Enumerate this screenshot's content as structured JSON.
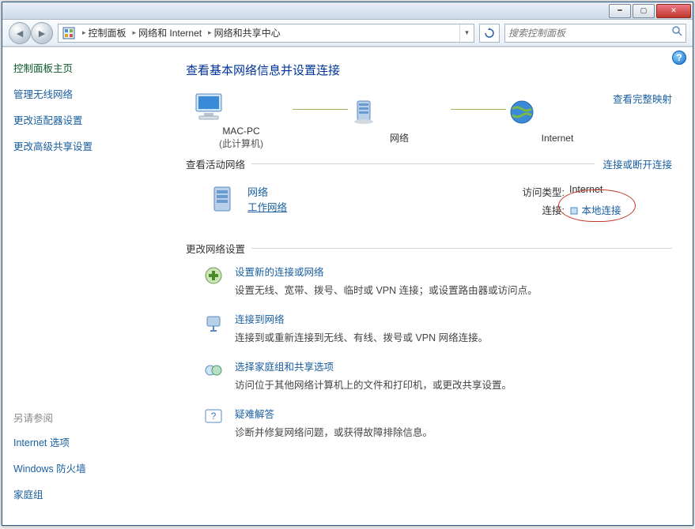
{
  "breadcrumb": {
    "seg1": "控制面板",
    "seg2": "网络和 Internet",
    "seg3": "网络和共享中心"
  },
  "search": {
    "placeholder": "搜索控制面板"
  },
  "sidebar": {
    "heading": "控制面板主页",
    "links": [
      "管理无线网络",
      "更改适配器设置",
      "更改高级共享设置"
    ],
    "seealso_h": "另请参阅",
    "seealso": [
      "Internet 选项",
      "Windows 防火墙",
      "家庭组"
    ]
  },
  "page": {
    "title": "查看基本网络信息并设置连接",
    "map_full_link": "查看完整映射",
    "map": {
      "node1": "MAC-PC",
      "node1_sub": "(此计算机)",
      "node2": "网络",
      "node3": "Internet"
    },
    "active_h": "查看活动网络",
    "active_link": "连接或断开连接",
    "active": {
      "name": "网络",
      "type": "工作网络",
      "access_k": "访问类型:",
      "access_v": "Internet",
      "conn_k": "连接:",
      "conn_v": "本地连接"
    },
    "settings_h": "更改网络设置",
    "tasks": [
      {
        "title": "设置新的连接或网络",
        "desc": "设置无线、宽带、拨号、临时或 VPN 连接；或设置路由器或访问点。"
      },
      {
        "title": "连接到网络",
        "desc": "连接到或重新连接到无线、有线、拨号或 VPN 网络连接。"
      },
      {
        "title": "选择家庭组和共享选项",
        "desc": "访问位于其他网络计算机上的文件和打印机，或更改共享设置。"
      },
      {
        "title": "疑难解答",
        "desc": "诊断并修复网络问题，或获得故障排除信息。"
      }
    ]
  }
}
